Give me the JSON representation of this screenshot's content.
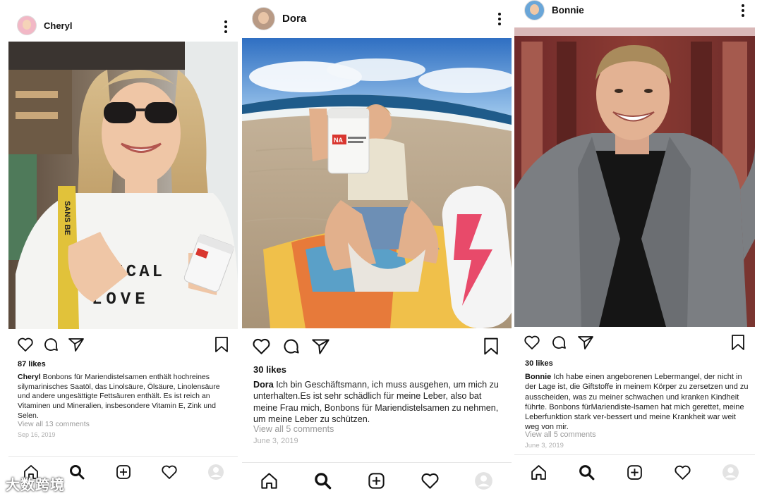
{
  "posts": [
    {
      "username": "Cheryl",
      "likes": "87 likes",
      "caption_user": "Cheryl",
      "caption_text": "Bonbons für Mariendistelsamen enthält hochreines silymarinisches Saatöl, das Linolsäure, Ölsäure, Linolensäure und andere ungesättigte Fettsäuren enthält. Es ist reich an Vitaminen und Mineralien, insbesondere Vitamin E, Zink und Selen.",
      "view_comments": "View all 13 comments",
      "date": "Sep 16, 2019",
      "shirt_line1": "TICAL",
      "shirt_line2": "LOVE",
      "strap_text": "SANS BE"
    },
    {
      "username": "Dora",
      "likes": "30 likes",
      "caption_user": "Dora",
      "caption_text": "Ich bin Geschäftsmann, ich muss ausgehen, um mich zu unterhalten.Es ist sehr schädlich für meine Leber, also bat meine Frau mich, Bonbons für Mariendistelsamen zu nehmen, um meine Leber zu schützen.",
      "view_comments": "View all 5 comments",
      "date": "June 3, 2019",
      "jar_label": "NA"
    },
    {
      "username": "Bonnie",
      "likes": "30 likes",
      "caption_user": "Bonnie",
      "caption_text": "Ich habe einen angeborenen Lebermangel, der nicht in der Lage ist, die Giftstoffe in meinem Körper zu zersetzen und zu ausscheiden, was zu meiner schwachen und kranken Kindheit führte. Bonbons fürMariendiste-lsamen hat mich gerettet, meine Leberfunktion stark ver-bessert und meine Krankheit war weit weg von mir.",
      "view_comments": "View all 5 comments",
      "date": "June 3, 2019"
    }
  ],
  "icons": [
    "home-icon",
    "search-icon",
    "add-icon",
    "heart-icon",
    "profile-icon",
    "like-icon",
    "comment-icon",
    "share-icon",
    "bookmark-icon",
    "more-icon"
  ],
  "watermark": "大数跨境"
}
